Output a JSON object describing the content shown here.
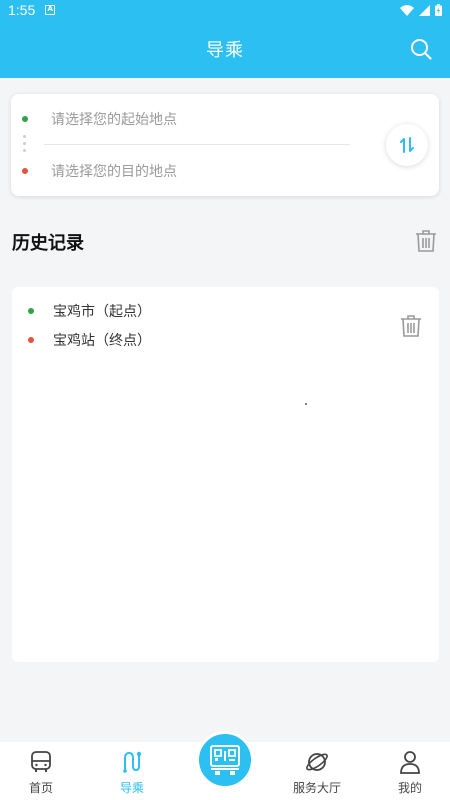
{
  "status_bar": {
    "time": "1:55",
    "notification_icon": "A"
  },
  "header": {
    "title": "导乘",
    "search_icon": "search-icon"
  },
  "route": {
    "start_placeholder": "请选择您的起始地点",
    "end_placeholder": "请选择您的目的地点",
    "swap_label": "⇅"
  },
  "history": {
    "title": "历史记录",
    "items": [
      {
        "start": "宝鸡市（起点）",
        "end": "宝鸡站（终点）"
      }
    ]
  },
  "tabs": [
    {
      "label": "首页",
      "icon": "bus-icon",
      "active": false
    },
    {
      "label": "导乘",
      "icon": "route-icon",
      "active": true
    },
    {
      "label": "服务大厅",
      "icon": "planet-icon",
      "active": false
    },
    {
      "label": "我的",
      "icon": "person-icon",
      "active": false
    }
  ],
  "colors": {
    "accent": "#2bbff2",
    "start_dot": "#2ea343",
    "end_dot": "#e5533a",
    "background": "#f4f5f7"
  }
}
